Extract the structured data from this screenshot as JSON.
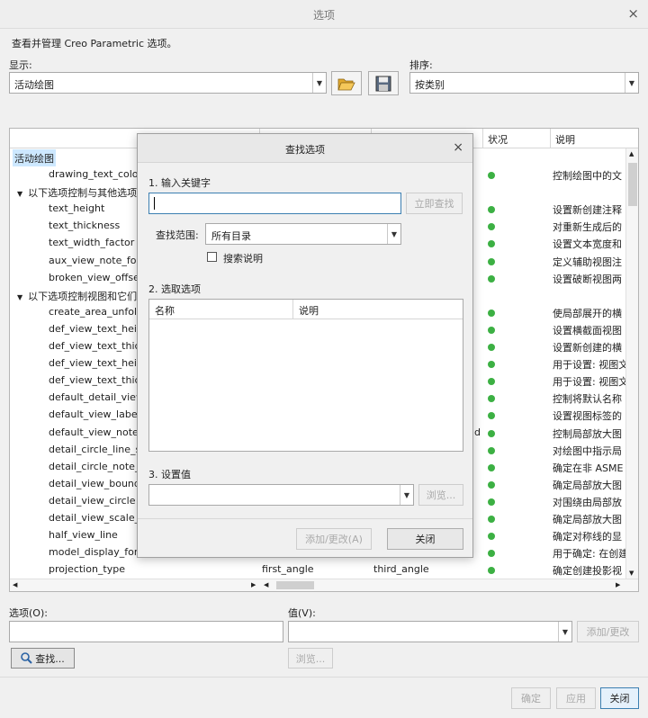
{
  "window": {
    "title": "选项",
    "close": "×"
  },
  "intro": "查看并管理 Creo Parametric 选项。",
  "display": {
    "label": "显示:",
    "value": "活动绘图"
  },
  "sort": {
    "label": "排序:",
    "value": "按类别"
  },
  "table": {
    "headers": [
      "状况",
      "说明"
    ],
    "root": "活动绘图",
    "groups": [
      {
        "label": "以下选项控制与其他选项",
        "start": 1
      },
      {
        "label": "以下选项控制视图和它们",
        "start": 6
      }
    ],
    "rows": [
      {
        "name": "drawing_text_colo",
        "desc": "控制绘图中的文"
      },
      {
        "name": "text_height",
        "desc": "设置新创建注释"
      },
      {
        "name": "text_thickness",
        "desc": "对重新生成后的"
      },
      {
        "name": "text_width_factor",
        "desc": "设置文本宽度和"
      },
      {
        "name": "aux_view_note_for",
        "desc": "定义辅助视图注"
      },
      {
        "name": "broken_view_offse",
        "desc": "设置破断视图两"
      },
      {
        "name": "create_area_unfol",
        "desc": "使局部展开的横"
      },
      {
        "name": "def_view_text_heig",
        "desc": "设置横截面视图"
      },
      {
        "name": "def_view_text_thick",
        "desc": "设置新创建的横"
      },
      {
        "name": "def_view_text_heig",
        "desc": "用于设置: 视图文"
      },
      {
        "name": "def_view_text_thick",
        "desc": "用于设置: 视图文"
      },
      {
        "name": "default_detail_view",
        "desc": "控制将默认名称"
      },
      {
        "name": "default_view_label",
        "desc": "设置视图标签的"
      },
      {
        "name": "default_view_note_",
        "desc": "控制局部放大图"
      },
      {
        "name": "detail_circle_line_s",
        "desc": "对绘图中指示局"
      },
      {
        "name": "detail_circle_note_",
        "desc": "确定在非 ASME"
      },
      {
        "name": "detail_view_bound",
        "desc": "确定局部放大图"
      },
      {
        "name": "detail_view_circle",
        "desc": "对围绕由局部放"
      },
      {
        "name": "detail_view_scale_f",
        "desc": "确定局部放大图"
      },
      {
        "name": "half_view_line",
        "desc": "确定对称线的显"
      },
      {
        "name": "model_display_for",
        "desc": "用于确定: 在创建"
      },
      {
        "name": "projection_type",
        "desc": "确定创建投影视",
        "value": "first_angle",
        "default": "third_angle"
      }
    ],
    "partial_d": "d"
  },
  "bottom": {
    "option_label": "选项(O):",
    "value_label": "值(V):",
    "add_change": "添加/更改",
    "find": "查找...",
    "browse": "浏览...",
    "ok": "确定",
    "apply": "应用",
    "close": "关闭"
  },
  "find_dialog": {
    "title": "查找选项",
    "close": "×",
    "step1": "1. 输入关键字",
    "find_now": "立即查找",
    "scope_label": "查找范围:",
    "scope_value": "所有目录",
    "search_desc": "搜索说明",
    "step2": "2. 选取选项",
    "col_name": "名称",
    "col_desc": "说明",
    "step3": "3. 设置值",
    "browse": "浏览...",
    "add_change": "添加/更改(A)",
    "close_btn": "关闭"
  },
  "colors": {
    "status_green": "#3cb043",
    "selection": "#cde8ff",
    "accent": "#3c7fb1"
  }
}
